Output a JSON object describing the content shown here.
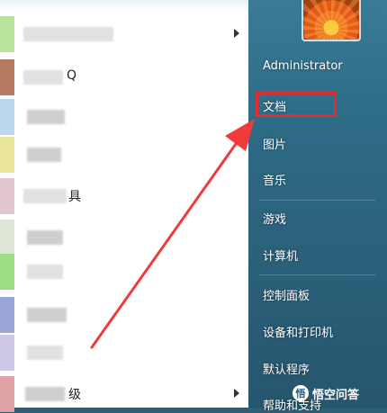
{
  "programs": [
    {
      "label": "",
      "has_arrow": true,
      "icon_color": "#b8e39a"
    },
    {
      "label": "Q",
      "has_arrow": false,
      "icon_color": "#b67a62"
    },
    {
      "label": "",
      "has_arrow": false,
      "icon_color": "#bcd6ec"
    },
    {
      "label": "",
      "has_arrow": false,
      "icon_color": "#e8e49a"
    },
    {
      "label": "具",
      "has_arrow": false,
      "icon_color": "#e3c5d0"
    },
    {
      "label": "",
      "has_arrow": false,
      "icon_color": "#dde6d6"
    },
    {
      "label": "",
      "has_arrow": false,
      "icon_color": "#9edc84"
    },
    {
      "label": "",
      "has_arrow": false,
      "icon_color": "#9ca4d8"
    },
    {
      "label": "",
      "has_arrow": false,
      "icon_color": "#cfc7e6"
    },
    {
      "label": "",
      "has_arrow": false,
      "icon_color": "#e6e6ea"
    },
    {
      "label": "级",
      "has_arrow": true,
      "icon_color": "#e0a3a8"
    }
  ],
  "user": {
    "name": "Administrator"
  },
  "menu": {
    "documents": "文档",
    "pictures": "图片",
    "music": "音乐",
    "games": "游戏",
    "computer": "计算机",
    "control_panel": "控制面板",
    "devices_printers": "设备和打印机",
    "default_programs": "默认程序",
    "help_support": "帮助和支持"
  },
  "watermark": {
    "logo": "悟",
    "text": "悟空问答"
  },
  "colors": {
    "highlight": "#e52b2b",
    "arrow": "#ef3b3b",
    "panel": "#2d6a85"
  }
}
